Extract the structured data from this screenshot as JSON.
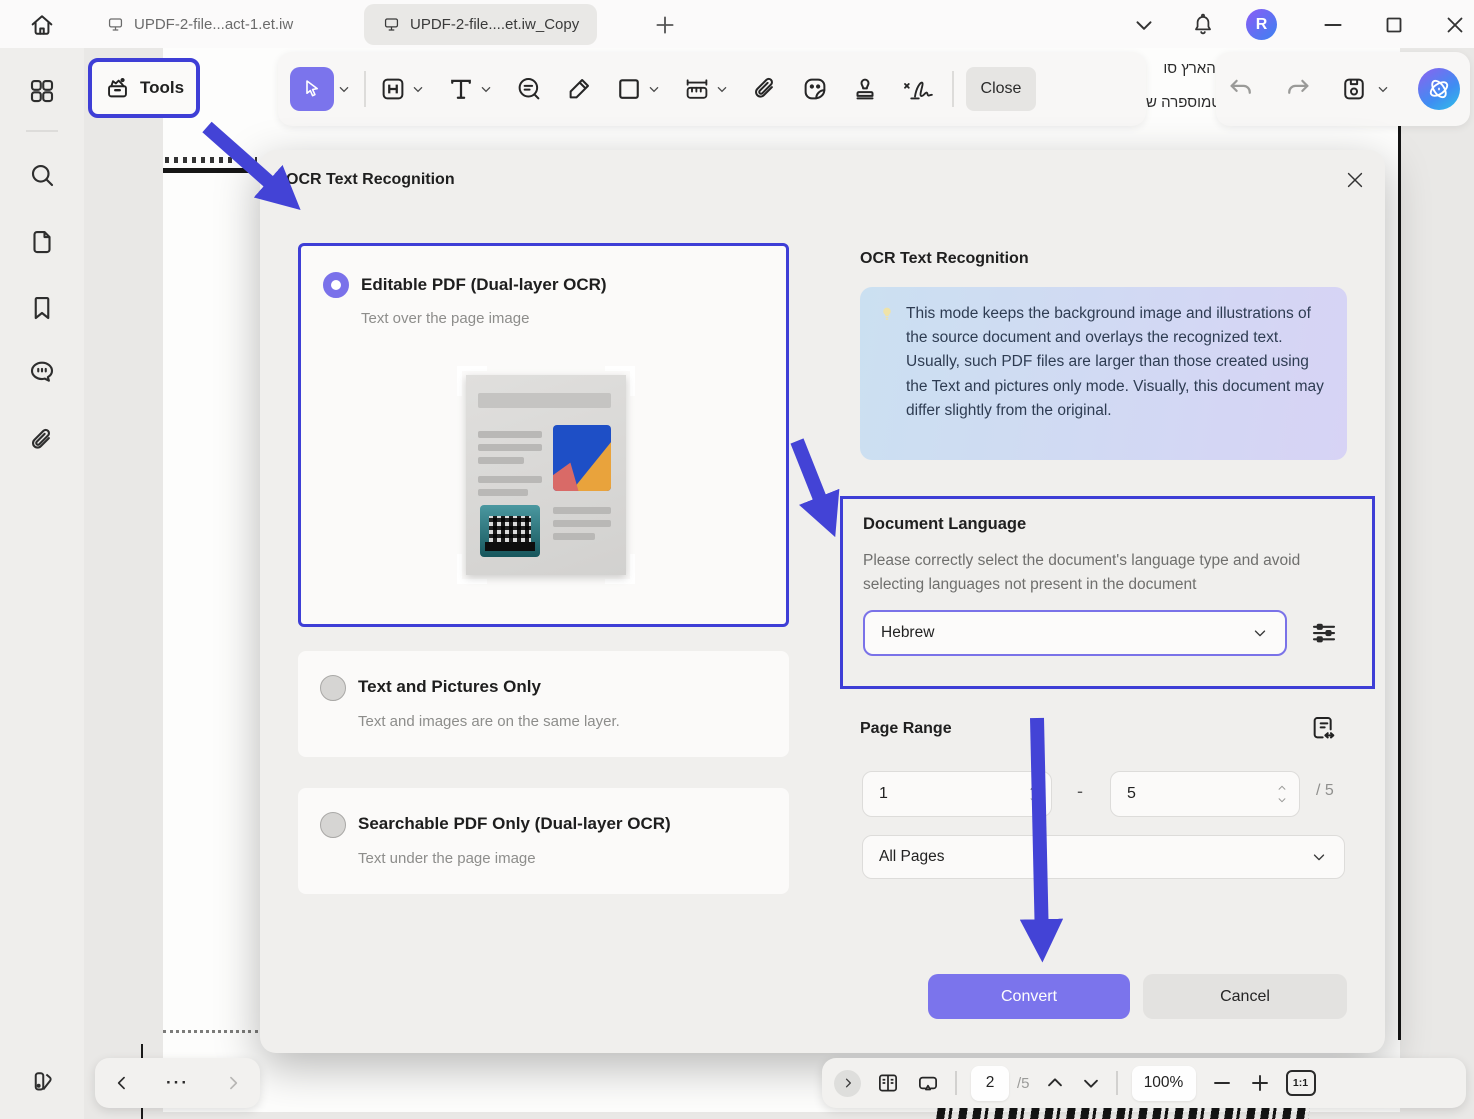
{
  "window": {
    "tabs": [
      {
        "label": "UPDF-2-file...act-1.et.iw"
      },
      {
        "label": "UPDF-2-file....et.iw_Copy"
      }
    ],
    "avatar_initial": "R"
  },
  "toolbar": {
    "tools_label": "Tools",
    "close_label": "Close"
  },
  "document_bg": {
    "hebrew_line_1": "כדור הארץ סו",
    "hebrew_line_2": "האטמוספרה ש"
  },
  "dialog": {
    "title": "OCR Text Recognition",
    "options": [
      {
        "title": "Editable PDF (Dual-layer OCR)",
        "subtitle": "Text over the page image",
        "selected": true
      },
      {
        "title": "Text and Pictures Only",
        "subtitle": "Text and images are on the same layer.",
        "selected": false
      },
      {
        "title": "Searchable PDF Only (Dual-layer OCR)",
        "subtitle": "Text under the page image",
        "selected": false
      }
    ],
    "info": {
      "heading": "OCR Text Recognition",
      "body": "This mode keeps the background image and illustrations of the source document and overlays the recognized text. Usually, such PDF files are larger than those created using the Text and pictures only mode. Visually, this document may differ slightly from the original."
    },
    "language": {
      "heading": "Document Language",
      "description": "Please correctly select the document's language type and avoid selecting languages not present in the document",
      "selected_value": "Hebrew"
    },
    "page_range": {
      "heading": "Page Range",
      "from_value": "1",
      "separator": "-",
      "to_value": "5",
      "total_label": "/ 5",
      "scope_value": "All Pages"
    },
    "convert_label": "Convert",
    "cancel_label": "Cancel"
  },
  "bottom_bar": {
    "more_glyph": "···",
    "page_current": "2",
    "page_total": "/5",
    "zoom_value": "100%",
    "fit_ratio": "1:1"
  },
  "colors": {
    "accent_purple": "#7b74ec",
    "annotation_blue": "#3e3ed6",
    "info_gradient_start": "#cbe0f1",
    "info_gradient_end": "#d7d3f5"
  }
}
